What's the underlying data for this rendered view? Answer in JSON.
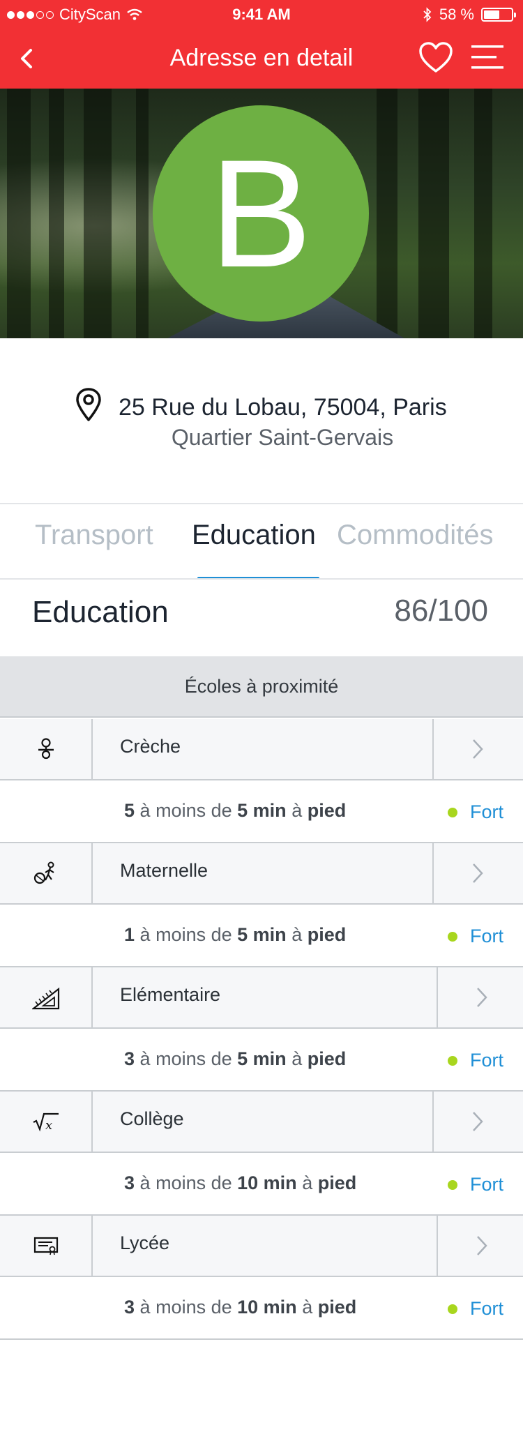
{
  "status_bar": {
    "carrier": "CityScan",
    "time": "9:41 AM",
    "battery": "58 %",
    "battery_level": 0.58
  },
  "navbar": {
    "title": "Adresse en detail"
  },
  "hero": {
    "grade": "B",
    "grade_color": "#6eb043"
  },
  "address": {
    "street": "25 Rue du Lobau, 75004, Paris",
    "neighborhood": "Quartier Saint-Gervais"
  },
  "tabs": [
    {
      "label": "Transport",
      "active": false
    },
    {
      "label": "Education",
      "active": true
    },
    {
      "label": "Commodités",
      "active": false
    }
  ],
  "score": {
    "title": "Education",
    "value": "86/100"
  },
  "section": {
    "title": "Écoles à proximité"
  },
  "categories": [
    {
      "label": "Crèche",
      "icon": "pacifier-icon",
      "count": "5",
      "text_within": "à moins de",
      "time": "5 min",
      "text_at": "à",
      "mode": "pied",
      "rating": "Fort"
    },
    {
      "label": "Maternelle",
      "icon": "child-ball-icon",
      "count": "1",
      "text_within": "à moins de",
      "time": "5 min",
      "text_at": "à",
      "mode": "pied",
      "rating": "Fort"
    },
    {
      "label": "Elémentaire",
      "icon": "ruler-triangle-icon",
      "count": "3",
      "text_within": "à moins de",
      "time": "5 min",
      "text_at": "à",
      "mode": "pied",
      "rating": "Fort"
    },
    {
      "label": "Collège",
      "icon": "square-root-icon",
      "count": "3",
      "text_within": "à moins de",
      "time": "10 min",
      "text_at": "à",
      "mode": "pied",
      "rating": "Fort"
    },
    {
      "label": "Lycée",
      "icon": "diploma-icon",
      "count": "3",
      "text_within": "à moins de",
      "time": "10 min",
      "text_at": "à",
      "mode": "pied",
      "rating": "Fort"
    }
  ],
  "colors": {
    "header": "#f23034",
    "accent_blue": "#1f8fd6",
    "rating_dot": "#a8d61e"
  }
}
